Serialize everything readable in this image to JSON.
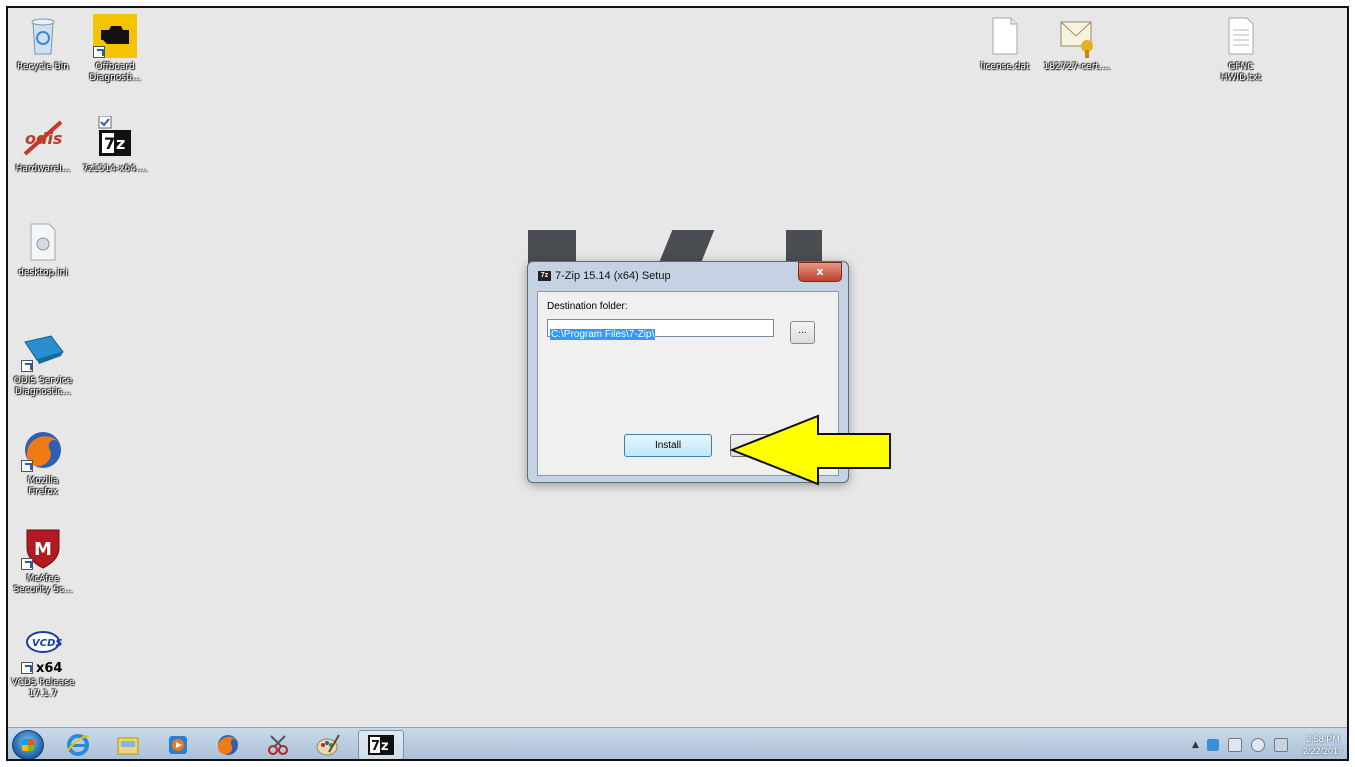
{
  "desktop": {
    "icons_left": [
      {
        "label": "Recycle Bin",
        "icon": "recycle-bin-icon"
      },
      {
        "label": "Offboard\nDiagnosti...",
        "icon": "engine-check-icon"
      },
      {
        "label": "HardwareI...",
        "icon": "odis-logo-icon"
      },
      {
        "label": "7z1514-x64....",
        "icon": "7zip-installer-icon"
      },
      {
        "label": "desktop.ini",
        "icon": "settings-file-icon"
      },
      {
        "label": "ODIS Service\nDiagnostic...",
        "icon": "diagnostic-interface-icon"
      },
      {
        "label": "Mozilla\nFirefox",
        "icon": "firefox-icon"
      },
      {
        "label": "McAfee\nSecurity Sc...",
        "icon": "mcafee-icon"
      },
      {
        "label": "VCDS Release\n17.1.7",
        "icon": "vcds-icon",
        "badge": "x64"
      }
    ],
    "icons_right": [
      {
        "label": "license.dat",
        "icon": "document-icon"
      },
      {
        "label": "182727-cert....",
        "icon": "certificate-icon"
      },
      {
        "label": "GFNC\nHWID.txt",
        "icon": "text-file-icon"
      }
    ]
  },
  "dialog": {
    "title": "7-Zip 15.14 (x64) Setup",
    "title_icon_text": "7z",
    "close_label": "x",
    "destination_label": "Destination folder:",
    "destination_value": "C:\\Program Files\\7-Zip\\",
    "browse_label": "...",
    "install_label": "Install"
  },
  "taskbar": {
    "items": [
      "internet-explorer-icon",
      "file-explorer-icon",
      "media-player-icon",
      "firefox-icon",
      "snipping-tool-icon",
      "paint-icon",
      "7zip-icon"
    ],
    "active_item": "7zip-icon",
    "active_item_text": "7z",
    "clock_time": "2:58 PM",
    "clock_date": "2/22/2017"
  },
  "colors": {
    "desktop_bg": "#e7e7e7",
    "arrow_fill": "#ffff00",
    "selection": "#3399ff"
  }
}
